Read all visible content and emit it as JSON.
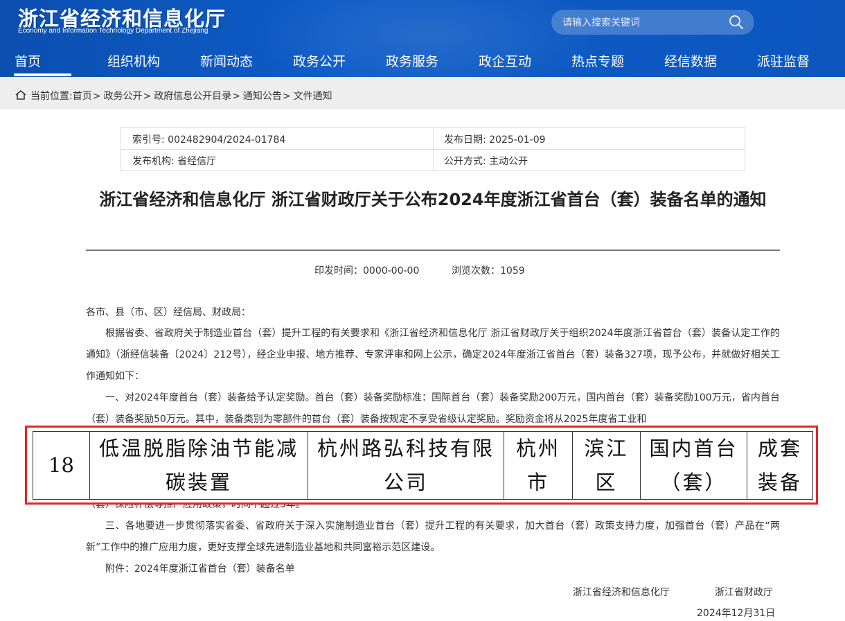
{
  "site": {
    "title_cn": "浙江省经济和信息化厅",
    "title_en": "Economy and Information Technology Department of Zhejiang"
  },
  "search": {
    "placeholder": "请输入搜索关键词"
  },
  "nav": {
    "items": [
      "首页",
      "组织机构",
      "新闻动态",
      "政务公开",
      "政务服务",
      "政企互动",
      "热点专题",
      "经信数据",
      "派驻监督"
    ],
    "active_index": 0
  },
  "breadcrumb": {
    "prefix": "当前位置:",
    "items": [
      "首页",
      "政务公开",
      "政府信息公开目录",
      "通知公告",
      "文件通知"
    ],
    "separator": ">"
  },
  "info": {
    "index_no": "索引号: 002482904/2024-01784",
    "publish_date": "发布日期: 2025-01-09",
    "publisher": "发布机构: 省经信厅",
    "disclosure": "公开方式: 主动公开"
  },
  "article": {
    "title": "浙江省经济和信息化厅 浙江省财政厅关于公布2024年度浙江省首台（套）装备名单的通知",
    "issue_time": "印发时间：0000-00-00",
    "views": "浏览次数：1059",
    "salutation": "各市、县（市、区）经信局、财政局：",
    "para1": "根据省委、省政府关于制造业首台（套）提升工程的有关要求和《浙江省经济和信息化厅 浙江省财政厅关于组织2024年度浙江省首台（套）装备认定工作的通知》（浙经信装备〔2024〕212号），经企业申报、地方推荐、专家评审和网上公示，确定2024年度浙江省首台（套）装备327项，现予公布，并就做好相关工作通知如下：",
    "para2": "一、对2024年度首台（套）装备给予认定奖励。首台（套）装备奖励标准：国际首台（套）装备奖励200万元，国内首台（套）装备奖励100万元，省内首台（套）装备奖励50万元。其中，装备类别为零部件的首台（套）装备按规定不享受省级认定奖励。奖励资金将从2025年度省工业和",
    "para2_tail": "（套）保险补偿等推广应用政策，时间不超过3年。",
    "para3": "三、各地要进一步贯彻落实省委、省政府关于深入实施制造业首台（套）提升工程的有关要求，加大首台（套）政策支持力度，加强首台（套）产品在“两新”工作中的推广应用力度，更好支撑全球先进制造业基地和共同富裕示范区建设。",
    "attachment": "附件：2024年度浙江省首台（套）装备名单",
    "signer1": "浙江省经济和信息化厅",
    "signer2": "浙江省财政厅",
    "sign_date": "2024年12月31日"
  },
  "overlay_row": {
    "no": "18",
    "name": "低温脱脂除油节能减碳装置",
    "name_line1": "低温脱脂除油节能减",
    "name_line2": "碳装置",
    "company": "杭州路弘科技有限公司",
    "company_line1": "杭州路弘科技有限",
    "company_line2": "公司",
    "city_line1": "杭州",
    "city_line2": "市",
    "district_line1": "滨江",
    "district_line2": "区",
    "level_line1": "国内首台",
    "level_line2": "（套）",
    "category_line1": "成套",
    "category_line2": "装备",
    "highlight_color": "#e0262b"
  },
  "colors": {
    "header_bg": "#0e5cc7",
    "breadcrumb_bg": "#eeeeee"
  }
}
